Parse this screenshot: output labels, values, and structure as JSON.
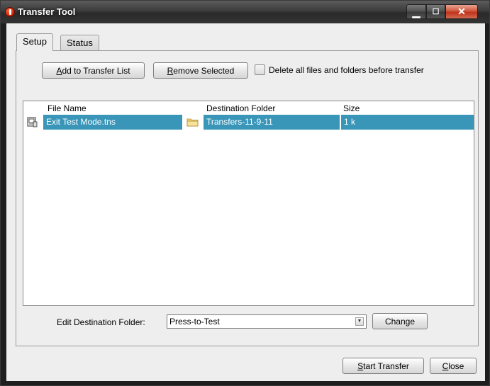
{
  "window": {
    "title": "Transfer Tool"
  },
  "tabs": [
    {
      "label": "Setup",
      "selected": true
    },
    {
      "label": "Status",
      "selected": false
    }
  ],
  "toolbar": {
    "add_pre": "",
    "add_mnemonic": "A",
    "add_post": "dd to Transfer List",
    "remove_pre": "",
    "remove_mnemonic": "R",
    "remove_post": "emove Selected",
    "delete_checkbox_label": "Delete all files and folders before transfer",
    "delete_checked": false
  },
  "table": {
    "columns": [
      "File Name",
      "Destination Folder",
      "Size"
    ],
    "rows": [
      {
        "file_name": "Exit Test Mode.tns",
        "destination": "Transfers-11-9-11",
        "size": "1 k",
        "selected": true
      }
    ]
  },
  "destination": {
    "label": "Edit Destination Folder:",
    "value": "Press-to-Test",
    "change_label": "Change"
  },
  "footer": {
    "start_pre": "",
    "start_mnemonic": "S",
    "start_post": "tart Transfer",
    "close_pre": "",
    "close_mnemonic": "C",
    "close_post": "lose"
  },
  "colors": {
    "selection": "#3996b9",
    "titlebar": "#3c3c3c",
    "close_button": "#c8452b",
    "panel": "#eeeeee"
  },
  "icons": {
    "app": "ti-nspire-icon",
    "file": "tns-document-icon",
    "folder": "folder-icon"
  }
}
